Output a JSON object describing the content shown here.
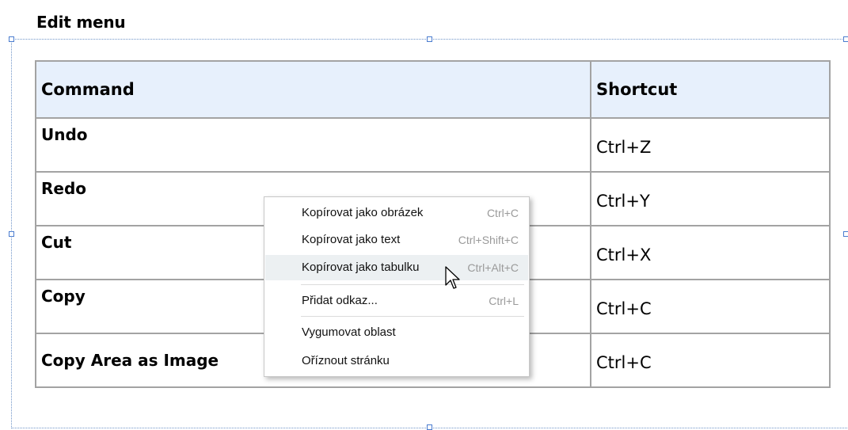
{
  "heading": "Edit menu",
  "table": {
    "headers": [
      "Command",
      "Shortcut"
    ],
    "rows": [
      {
        "command": "Undo",
        "shortcut": "Ctrl+Z"
      },
      {
        "command": "Redo",
        "shortcut": "Ctrl+Y"
      },
      {
        "command": "Cut",
        "shortcut": "Ctrl+X"
      },
      {
        "command": "Copy",
        "shortcut": "Ctrl+C"
      },
      {
        "command": "Copy Area as Image",
        "shortcut": "Ctrl+C"
      }
    ]
  },
  "context_menu": {
    "items": [
      {
        "label": "Kopírovat jako obrázek",
        "shortcut": "Ctrl+C"
      },
      {
        "label": "Kopírovat jako text",
        "shortcut": "Ctrl+Shift+C"
      },
      {
        "label": "Kopírovat jako tabulku",
        "shortcut": "Ctrl+Alt+C",
        "hovered": true
      },
      {
        "label": "Přidat odkaz...",
        "shortcut": "Ctrl+L"
      },
      {
        "label": "Vygumovat oblast",
        "shortcut": ""
      },
      {
        "label": "Oříznout stránku",
        "shortcut": ""
      }
    ]
  },
  "colors": {
    "header_bg": "#e7f0fc",
    "selection_frame": "#6f94c8",
    "menu_hover": "#ecf0f2"
  }
}
